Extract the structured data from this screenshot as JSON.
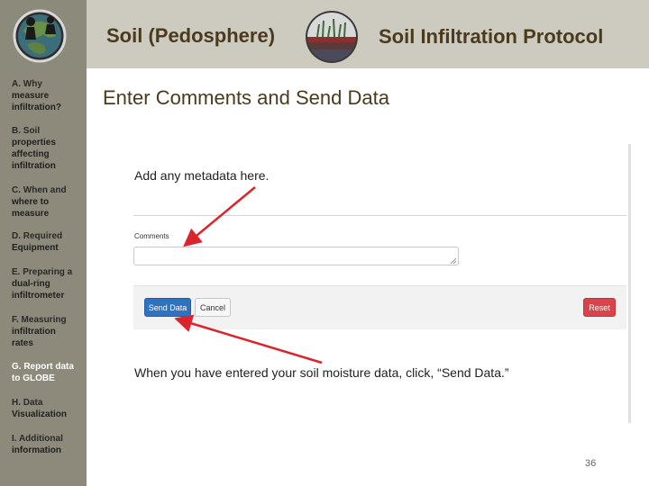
{
  "header": {
    "left_title": "Soil (Pedosphere)",
    "right_title": "Soil Infiltration Protocol",
    "logo_icon": "globe-program-logo-icon",
    "soil_image_icon": "soil-profile-circle-icon"
  },
  "sidebar": {
    "items": [
      {
        "lines": [
          "A. Why",
          "measure",
          "infiltration?"
        ]
      },
      {
        "lines": [
          "B. Soil",
          "properties",
          "affecting",
          "infiltration"
        ]
      },
      {
        "lines": [
          "C. When and",
          "where to",
          "measure"
        ]
      },
      {
        "lines": [
          "D. Required",
          "Equipment"
        ]
      },
      {
        "lines": [
          "E. Preparing a",
          "dual-ring",
          "infiltrometer"
        ]
      },
      {
        "lines": [
          "F. Measuring",
          "infiltration",
          "rates"
        ]
      },
      {
        "lines": [
          "G. Report data",
          "to GLOBE"
        ]
      },
      {
        "lines": [
          "H. Data",
          "Visualization"
        ]
      },
      {
        "lines": [
          "I. Additional",
          "information"
        ]
      }
    ]
  },
  "main": {
    "title": "Enter Comments and Send Data",
    "metadata_note": "Add any metadata here.",
    "comments_label": "Comments",
    "comments_value": "",
    "send_button": "Send Data",
    "cancel_button": "Cancel",
    "reset_button": "Reset",
    "send_note": "When you have entered your soil moisture data, click, “Send Data.”",
    "page_number": "36"
  },
  "colors": {
    "header_bg": "#cdcbbf",
    "sidebar_bg": "#8d8a7b",
    "title_brown": "#4a3a1e",
    "send_blue": "#2f72c0",
    "reset_red": "#d9434b",
    "arrow_red": "#d9252b"
  }
}
